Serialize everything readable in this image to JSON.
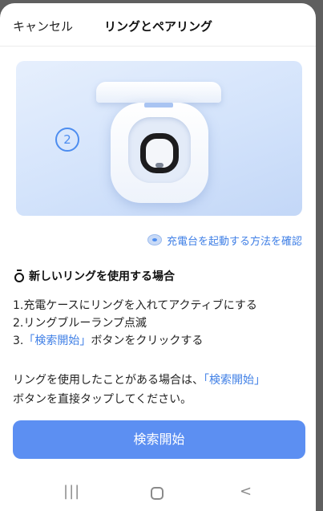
{
  "header": {
    "cancel_label": "キャンセル",
    "title": "リングとペアリング"
  },
  "hero": {
    "step_number": "2",
    "illustration": "ring-in-charging-case"
  },
  "help_link": {
    "icon": "charger-icon",
    "label": "充電台を起動する方法を確認"
  },
  "section": {
    "icon": "ring-icon",
    "title": "新しいリングを使用する場合"
  },
  "steps": {
    "step1": "1.充電ケースにリングを入れてアクティブにする",
    "step2": "2.リングブルーランプ点滅",
    "step3_prefix": "3.",
    "step3_highlight": "「検索開始」",
    "step3_suffix": "ボタンをクリックする"
  },
  "note": {
    "line1_prefix": "リングを使用したことがある場合は、",
    "line1_highlight": "「検索開始」",
    "line2": "ボタンを直接タップしてください。"
  },
  "primary_button": {
    "label": "検索開始"
  },
  "navbar": {
    "recents_glyph": "|||",
    "back_glyph": "<"
  },
  "colors": {
    "accent": "#3f7fe6",
    "button": "#5c8ff2",
    "hero_bg": "#d3e3fb"
  }
}
